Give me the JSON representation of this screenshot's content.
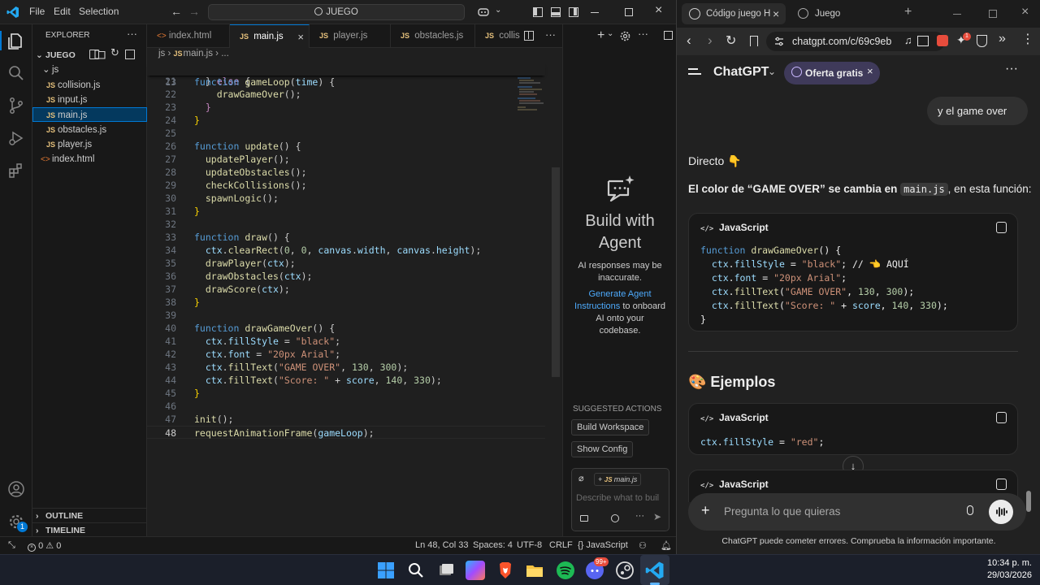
{
  "vscode": {
    "menu": [
      "File",
      "Edit",
      "Selection"
    ],
    "search": "JUEGO",
    "explorer_title": "EXPLORER",
    "folder": "JUEGO",
    "subfolder": "js",
    "files": [
      "collision.js",
      "input.js",
      "main.js",
      "obstacles.js",
      "player.js"
    ],
    "root_file": "index.html",
    "outline": "OUTLINE",
    "timeline": "TIMELINE",
    "tabs": [
      "index.html",
      "main.js",
      "player.js",
      "obstacles.js",
      "collis"
    ],
    "breadcrumb": [
      "js",
      "main.js",
      "..."
    ],
    "sticky_line_no": "13",
    "sticky_code": "function gameLoop(time) {",
    "line_numbers": [
      "21",
      "22",
      "23",
      "24",
      "25",
      "26",
      "27",
      "28",
      "29",
      "30",
      "31",
      "32",
      "33",
      "34",
      "35",
      "36",
      "37",
      "38",
      "39",
      "40",
      "41",
      "42",
      "43",
      "44",
      "45",
      "46",
      "47",
      "48"
    ],
    "agent": {
      "title": "Build with Agent",
      "disclaimer": "AI responses may be inaccurate.",
      "link": "Generate Agent Instructions",
      "link_suffix": "to onboard AI onto your codebase.",
      "suggested": "SUGGESTED ACTIONS",
      "btn1": "Build Workspace",
      "btn2": "Show Config",
      "context_file": "main.js",
      "input_placeholder": "Describe what to buil"
    },
    "status": {
      "errors": "0",
      "warnings": "0",
      "position": "Ln 48, Col 33",
      "spaces": "Spaces: 4",
      "encoding": "UTF-8",
      "eol": "CRLF",
      "language": "JavaScript"
    },
    "accounts_badge": "1"
  },
  "browser": {
    "tab1": "Código juego H",
    "tab2": "Juego",
    "url": "chatgpt.com/c/69c9eb",
    "app_name": "ChatGPT",
    "offer": "Oferta gratis",
    "user_msg": "y el game over",
    "reply_intro": "Directo 👇",
    "reply_text_pre": "El color de “GAME OVER” se cambia en",
    "reply_code_inline": "main.js",
    "reply_text_post": ", en esta función:",
    "code_lang": "JavaScript",
    "code_lines": [
      "function drawGameOver() {",
      "  ctx.fillStyle = \"black\"; // 👈 AQUÍ",
      "  ctx.font = \"20px Arial\";",
      "  ctx.fillText(\"GAME OVER\", 130, 300);",
      "  ctx.fillText(\"Score: \" + score, 140, 330);",
      "}"
    ],
    "section_title": "🎨 Ejemplos",
    "example_code": "ctx.fillStyle = \"red\";",
    "composer_placeholder": "Pregunta lo que quieras",
    "footer": "ChatGPT puede cometer errores. Comprueba la información importante."
  },
  "taskbar": {
    "time": "10:34 p. m.",
    "date": "29/03/2026",
    "discord_badge": "99+"
  }
}
